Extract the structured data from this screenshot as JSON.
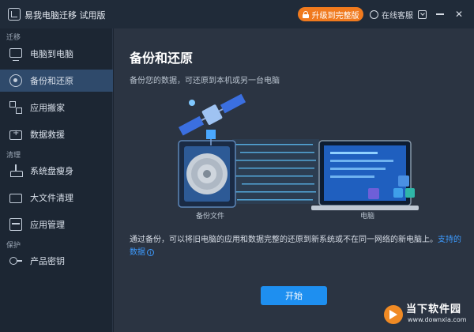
{
  "titlebar": {
    "app_title": "易我电脑迁移 试用版",
    "upgrade_label": "升级到完整版",
    "service_label": "在线客服",
    "close_glyph": "✕"
  },
  "sidebar": {
    "sections": [
      {
        "label": "迁移",
        "items": [
          {
            "label": "电脑到电脑",
            "icon": "monitor-icon"
          },
          {
            "label": "备份和还原",
            "icon": "backup-icon",
            "active": true
          },
          {
            "label": "应用搬家",
            "icon": "apps-icon"
          },
          {
            "label": "数据救援",
            "icon": "rescue-icon"
          }
        ]
      },
      {
        "label": "清理",
        "items": [
          {
            "label": "系统盘瘦身",
            "icon": "broom-icon"
          },
          {
            "label": "大文件清理",
            "icon": "folder-icon"
          },
          {
            "label": "应用管理",
            "icon": "grid-icon"
          }
        ]
      },
      {
        "label": "保护",
        "items": [
          {
            "label": "产品密钥",
            "icon": "key-icon"
          }
        ]
      }
    ]
  },
  "main": {
    "title": "备份和还原",
    "subtitle": "备份您的数据，可还原到本机或另一台电脑",
    "caption_left": "备份文件",
    "caption_right": "电脑",
    "description": "通过备份，可以将旧电脑的应用和数据完整的还原到新系统或不在同一网络的新电脑上。",
    "link_text": "支持的数据",
    "info_glyph": "i",
    "start_button": "开始"
  },
  "watermark": {
    "text": "当下软件园",
    "url": "www.downxia.com"
  },
  "colors": {
    "accent": "#1e8ff0",
    "upgrade": "#f07a1e",
    "active_nav": "#2f4a6b",
    "link": "#3d9bff"
  }
}
